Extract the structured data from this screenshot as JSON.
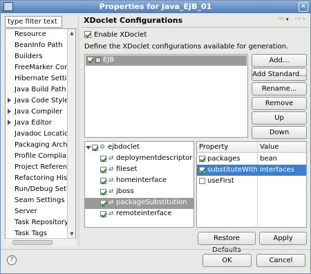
{
  "window": {
    "title": "Properties for Java_EJB_01"
  },
  "filter": {
    "placeholder": "type filter text"
  },
  "sidebar": {
    "items": [
      {
        "label": "Resource",
        "expandable": false
      },
      {
        "label": "BeanInfo Path",
        "expandable": false
      },
      {
        "label": "Builders",
        "expandable": false
      },
      {
        "label": "FreeMarker Cont",
        "expandable": false
      },
      {
        "label": "Hibernate Settin",
        "expandable": false
      },
      {
        "label": "Java Build Path",
        "expandable": false
      },
      {
        "label": "Java Code Style",
        "expandable": true
      },
      {
        "label": "Java Compiler",
        "expandable": true
      },
      {
        "label": "Java Editor",
        "expandable": true
      },
      {
        "label": "Javadoc Location",
        "expandable": false
      },
      {
        "label": "Packaging Archiv",
        "expandable": false
      },
      {
        "label": "Profile Complian",
        "expandable": false
      },
      {
        "label": "Project Reference",
        "expandable": false
      },
      {
        "label": "Refactoring Histo",
        "expandable": false
      },
      {
        "label": "Run/Debug Setti",
        "expandable": false
      },
      {
        "label": "Seam Settings",
        "expandable": false
      },
      {
        "label": "Server",
        "expandable": false
      },
      {
        "label": "Task Repository",
        "expandable": false
      },
      {
        "label": "Task Tags",
        "expandable": false
      }
    ]
  },
  "page": {
    "title": "XDoclet Configurations",
    "enable_label": "Enable XDoclet",
    "enable_checked": true,
    "description": "Define the XDoclet configurations available for generation."
  },
  "configs": [
    {
      "label": "EJB",
      "checked": true
    }
  ],
  "buttons": {
    "add": "Add...",
    "add_standard": "Add Standard...",
    "rename": "Rename...",
    "remove": "Remove",
    "up": "Up",
    "down": "Down",
    "restore_defaults": "Restore Defaults",
    "apply": "Apply",
    "ok": "OK",
    "cancel": "Cancel"
  },
  "tree": {
    "root": "ejbdoclet",
    "children": [
      {
        "label": "deploymentdescriptor",
        "checked": true
      },
      {
        "label": "fileset",
        "checked": true
      },
      {
        "label": "homeinterface",
        "checked": true
      },
      {
        "label": "jboss",
        "checked": true
      },
      {
        "label": "packageSubstitution",
        "checked": true,
        "selected": true
      },
      {
        "label": "remoteinterface",
        "checked": true
      }
    ]
  },
  "properties": {
    "columns": [
      "Property",
      "Value"
    ],
    "rows": [
      {
        "property": "packages",
        "value": "bean",
        "checked": true
      },
      {
        "property": "substituteWith",
        "value": "interfaces",
        "checked": true,
        "selected": true
      },
      {
        "property": "useFirst",
        "value": "",
        "checked": false
      }
    ]
  }
}
